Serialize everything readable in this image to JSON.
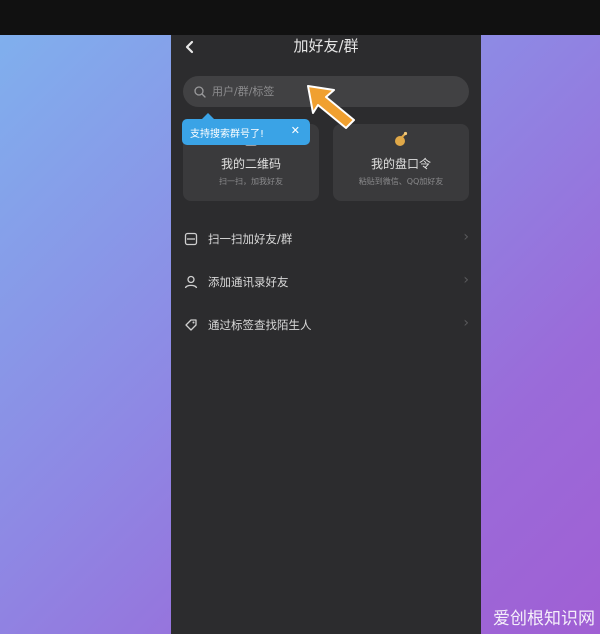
{
  "header": {
    "back_icon": "chevron-left-icon",
    "title": "加好友/群"
  },
  "search": {
    "placeholder": "用户/群/标签",
    "icon": "search-icon"
  },
  "tooltip": {
    "text": "支持搜索群号了!",
    "close": "✕"
  },
  "cards": [
    {
      "title": "我的二维码",
      "subtitle": "扫一扫，加我好友",
      "icon": "qr-code-icon"
    },
    {
      "title": "我的盘口令",
      "subtitle": "粘贴到微信、QQ加好友",
      "icon": "token-icon"
    }
  ],
  "list": [
    {
      "label": "扫一扫加好友/群",
      "icon": "scan-icon"
    },
    {
      "label": "添加通讯录好友",
      "icon": "contact-icon"
    },
    {
      "label": "通过标签查找陌生人",
      "icon": "tag-icon"
    }
  ],
  "watermark": "爱创根知识网",
  "colors": {
    "phone_bg": "#2c2c2e",
    "card_bg": "#3a3a3c",
    "tooltip_bg": "#3aa3e6",
    "arrow": "#f0a030"
  }
}
